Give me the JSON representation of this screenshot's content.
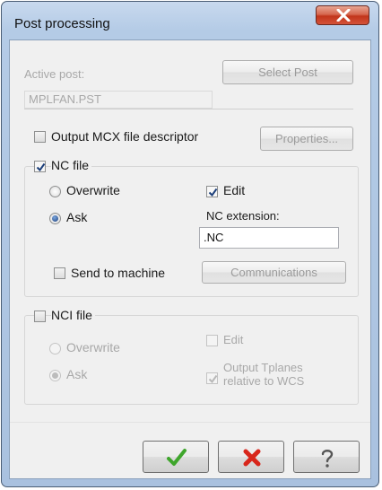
{
  "window": {
    "title": "Post processing"
  },
  "post": {
    "active_label": "Active post:",
    "select_button": "Select Post",
    "path": "MPLFAN.PST"
  },
  "mcx": {
    "label": "Output MCX file descriptor",
    "checked": false,
    "properties_button": "Properties..."
  },
  "nc_file": {
    "label": "NC file",
    "checked": true,
    "overwrite_label": "Overwrite",
    "ask_label": "Ask",
    "selected": "Ask",
    "edit_label": "Edit",
    "edit_checked": true,
    "extension_label": "NC extension:",
    "extension_value": ".NC",
    "send_label": "Send to machine",
    "send_checked": false,
    "communications_button": "Communications"
  },
  "nci_file": {
    "label": "NCI file",
    "checked": false,
    "overwrite_label": "Overwrite",
    "ask_label": "Ask",
    "selected": "Ask",
    "edit_label": "Edit",
    "edit_checked": false,
    "tplanes_label_line1": "Output Tplanes",
    "tplanes_label_line2": "relative to WCS",
    "tplanes_checked": true
  },
  "footer": {
    "ok_icon": "checkmark-icon",
    "cancel_icon": "red-x-icon",
    "help_icon": "question-mark-icon"
  },
  "colors": {
    "ok_green": "#3fa62c",
    "cancel_red": "#d8261b"
  }
}
